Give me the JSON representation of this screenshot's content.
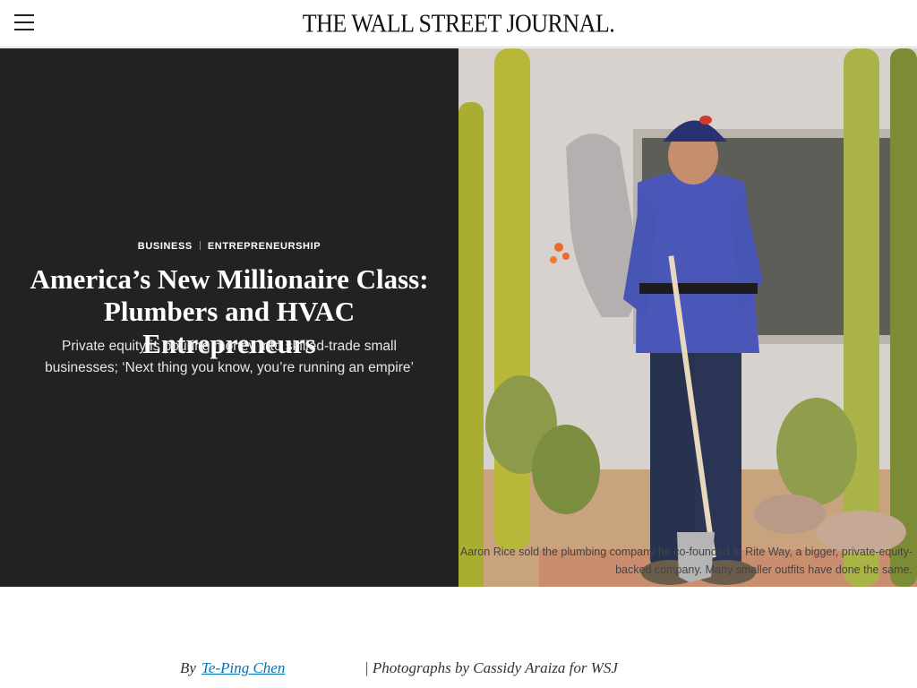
{
  "header": {
    "menu_icon": "hamburger-menu-icon",
    "logo_text": "THE WALL STREET JOURNAL."
  },
  "article": {
    "kickers": [
      "BUSINESS",
      "ENTREPRENEURSHIP"
    ],
    "headline": "America’s New Millionaire Class: Plumbers and HVAC Entrepreneurs",
    "dek": "Private equity is pouring money into skilled-trade small businesses; ‘Next thing you know, you’re running an empire’",
    "caption": "Aaron Rice sold the plumbing company he co-founded to Rite Way, a bigger, private-equity-backed company. Many smaller outfits have done the same.",
    "byline": {
      "prefix": "By",
      "author": "Te-Ping Chen",
      "photo_credit": "| Photographs by Cassidy Araiza for WSJ"
    }
  },
  "colors": {
    "hero_panel": "#222222",
    "author_link": "#0274b6",
    "wall": "#d9d4cf",
    "shirt": "#4a57b8",
    "pants": "#27324f",
    "cactus": "#b7b83a"
  }
}
